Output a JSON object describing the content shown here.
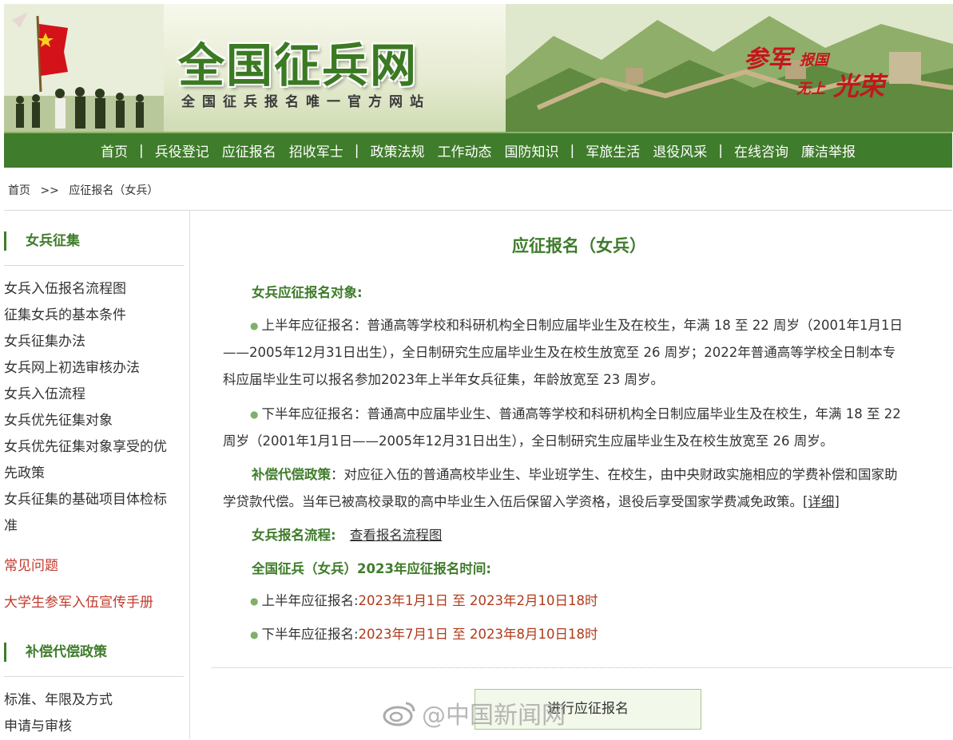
{
  "banner": {
    "site_name": "全国征兵网",
    "slogan": "全国征兵报名唯一官方网站",
    "motto": [
      "参军",
      "报国",
      "无上",
      "光荣"
    ]
  },
  "nav": {
    "items": [
      "首页",
      "兵役登记",
      "应征报名",
      "招收军士",
      "政策法规",
      "工作动态",
      "国防知识",
      "军旅生活",
      "退役风采",
      "在线咨询",
      "廉洁举报"
    ],
    "separator": "|"
  },
  "breadcrumb": {
    "home": "首页",
    "arrow": ">>",
    "current": "应征报名（女兵）"
  },
  "sidebar": {
    "section1_title": "女兵征集",
    "section1_items": [
      "女兵入伍报名流程图",
      "征集女兵的基本条件",
      "女兵征集办法",
      "女兵网上初选审核办法",
      "女兵入伍流程",
      "女兵优先征集对象",
      "女兵优先征集对象享受的优",
      "先政策",
      "女兵征集的基础项目体检标",
      "准"
    ],
    "faq": "常见问题",
    "handbook": "大学生参军入伍宣传手册",
    "section2_title": "补偿代偿政策",
    "section2_items": [
      "标准、年限及方式",
      "申请与审核"
    ]
  },
  "main": {
    "title": "应征报名（女兵）",
    "target_label": "女兵应征报名对象:",
    "first_half_lines": [
      "上半年应征报名：普通高等学校和科研机构全日制应届毕业生及在校生，年满 18 至 22 周岁（2001年1月1日",
      "——2005年12月31日出生），全日制研究生应届毕业生及在校生放宽至 26 周岁；2022年普通高等学校全日制本专",
      "科应届毕业生可以报名参加2023年上半年女兵征集，年龄放宽至 23 周岁。"
    ],
    "second_half_lines": [
      "下半年应征报名：普通高中应届毕业生、普通高等学校和科研机构全日制应届毕业生及在校生，年满 18 至 22",
      "周岁（2001年1月1日——2005年12月31日出生），全日制研究生应届毕业生及在校生放宽至 26 周岁。"
    ],
    "comp_label": "补偿代偿政策",
    "comp_lines": [
      "：对应征入伍的普通高校毕业生、毕业班学生、在校生，由中央财政实施相应的学费补偿和国家助",
      "学贷款代偿。当年已被高校录取的高中毕业生入伍后保留入学资格，退役后享受国家学费减免政策。"
    ],
    "detail_link": "[详细]",
    "process_label": "女兵报名流程:",
    "process_link": "查看报名流程图",
    "time_title": "全国征兵（女兵）2023年应征报名时间:",
    "time1_label": "上半年应征报名:",
    "time1_value": "2023年1月1日 至 2023年2月10日18时",
    "time2_label": "下半年应征报名:",
    "time2_value": "2023年7月1日 至 2023年8月10日18时",
    "apply_button": "进行应征报名"
  },
  "watermark": "@中国新闻网",
  "colors": {
    "brand_green": "#3f7c2b",
    "accent_red": "#b03a1a"
  }
}
